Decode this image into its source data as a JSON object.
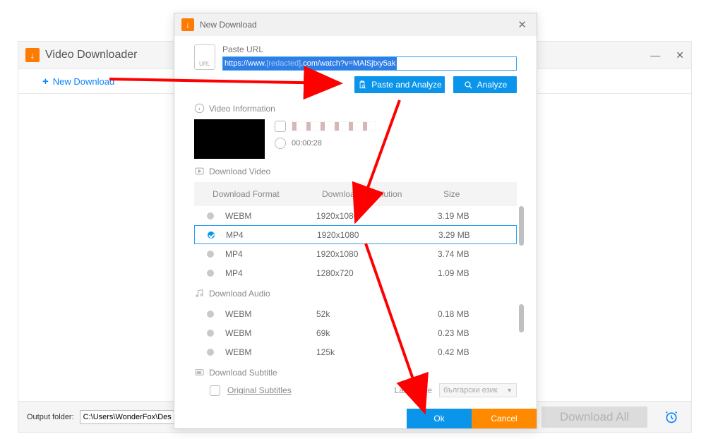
{
  "app": {
    "title": "Video Downloader",
    "new_download_btn": "New Download",
    "footer_label": "Output folder:",
    "footer_path": "C:\\Users\\WonderFox\\Desktop",
    "download_all_btn": "Download All"
  },
  "modal": {
    "title": "New Download",
    "paste_url_label": "Paste URL",
    "url_value_prefix": "https://www.",
    "url_value_mid": "[redacted]",
    "url_value_suffix": ".com/watch?v=MAlSjtxy5ak",
    "btn_paste_analyze": "Paste and Analyze",
    "btn_analyze": "Analyze",
    "video_info_label": "Video Information",
    "duration": "00:00:28",
    "download_video_label": "Download Video",
    "col_format": "Download Format",
    "col_resolution": "Download Resolution",
    "col_size": "Size",
    "video_rows": [
      {
        "format": "WEBM",
        "res": "1920x1080",
        "size": "3.19 MB",
        "selected": false
      },
      {
        "format": "MP4",
        "res": "1920x1080",
        "size": "3.29 MB",
        "selected": true
      },
      {
        "format": "MP4",
        "res": "1920x1080",
        "size": "3.74 MB",
        "selected": false
      },
      {
        "format": "MP4",
        "res": "1280x720",
        "size": "1.09 MB",
        "selected": false
      }
    ],
    "download_audio_label": "Download Audio",
    "audio_rows": [
      {
        "format": "WEBM",
        "res": "52k",
        "size": "0.18 MB"
      },
      {
        "format": "WEBM",
        "res": "69k",
        "size": "0.23 MB"
      },
      {
        "format": "WEBM",
        "res": "125k",
        "size": "0.42 MB"
      }
    ],
    "download_subtitle_label": "Download Subtitle",
    "original_subtitles_label": "Original Subtitles",
    "language_label": "Language",
    "language_value": "български език",
    "btn_ok": "Ok",
    "btn_cancel": "Cancel"
  },
  "colors": {
    "primary": "#0a95eb",
    "accent": "#ff8a00"
  }
}
